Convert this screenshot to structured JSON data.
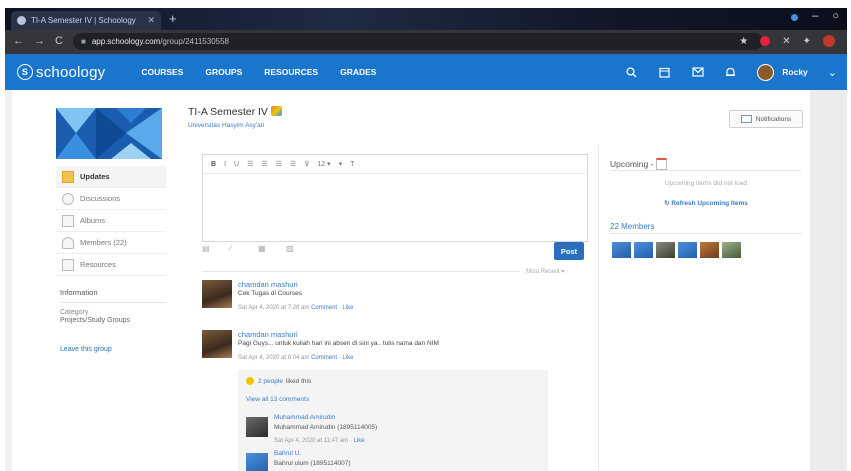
{
  "browser": {
    "tab_title": "TI-A Semester IV | Schoology",
    "new_tab": "+",
    "url_host": "app.schoology.com",
    "url_path": "/group/2411530558"
  },
  "nav": {
    "logo_text": "schoology",
    "links": [
      "COURSES",
      "GROUPS",
      "RESOURCES",
      "GRADES"
    ],
    "user_name": "Rocky"
  },
  "sidebar": {
    "items": [
      {
        "label": "Updates",
        "icon": "folder-icon"
      },
      {
        "label": "Discussions",
        "icon": "discussion-icon"
      },
      {
        "label": "Albums",
        "icon": "album-icon"
      },
      {
        "label": "Members (22)",
        "icon": "members-icon"
      },
      {
        "label": "Resources",
        "icon": "resources-icon"
      }
    ],
    "info_label": "Information",
    "category_label": "Category",
    "category_value": "Projects/Study Groups",
    "leave_label": "Leave this group"
  },
  "group": {
    "title": "TI-A Semester IV",
    "subtitle": "Universitas Hasyim Asy'ari"
  },
  "editor": {
    "toolbar": [
      "B",
      "I",
      "U",
      "12 ▾",
      "▾",
      "T"
    ],
    "post_label": "Post",
    "sort_label": "Most Recent ▾"
  },
  "posts": [
    {
      "author": "chamdan mashuri",
      "text": "Cek Tugas di Courses",
      "date": "Sat Apr 4, 2020 at 7:28 am",
      "comment_label": "Comment",
      "like_label": "Like"
    },
    {
      "author": "chamdan mashuri",
      "text": "Pagi Guys... untuk kuliah hari ini absen di sini ya.. tulis nama dan NIM",
      "date": "Sat Apr 4, 2020 at 6:04 am",
      "comment_label": "Comment",
      "like_label": "Like"
    }
  ],
  "comments_box": {
    "likes_link": "2 people",
    "likes_suffix": "liked this",
    "view_all": "View all 13 comments",
    "comments": [
      {
        "author": "Muhammad Amirudin",
        "text": "Muhammad Amirudin (1895114005)",
        "date": "Sat Apr 4, 2020 at 11:47 am",
        "like_label": "Like"
      },
      {
        "author": "Bahrul U.",
        "text": "Bahrul ulum (1895114007)"
      }
    ]
  },
  "right": {
    "notifications_label": "Notifications",
    "upcoming_title": "Upcoming -",
    "upcoming_empty": "Upcoming items did not load",
    "refresh_label": "Refresh Upcoming Items",
    "members_title": "22 Members"
  },
  "colors": {
    "nav_blue": "#1a75cc",
    "link_blue": "#3a7bc8",
    "post_button": "#2a6fbd"
  }
}
